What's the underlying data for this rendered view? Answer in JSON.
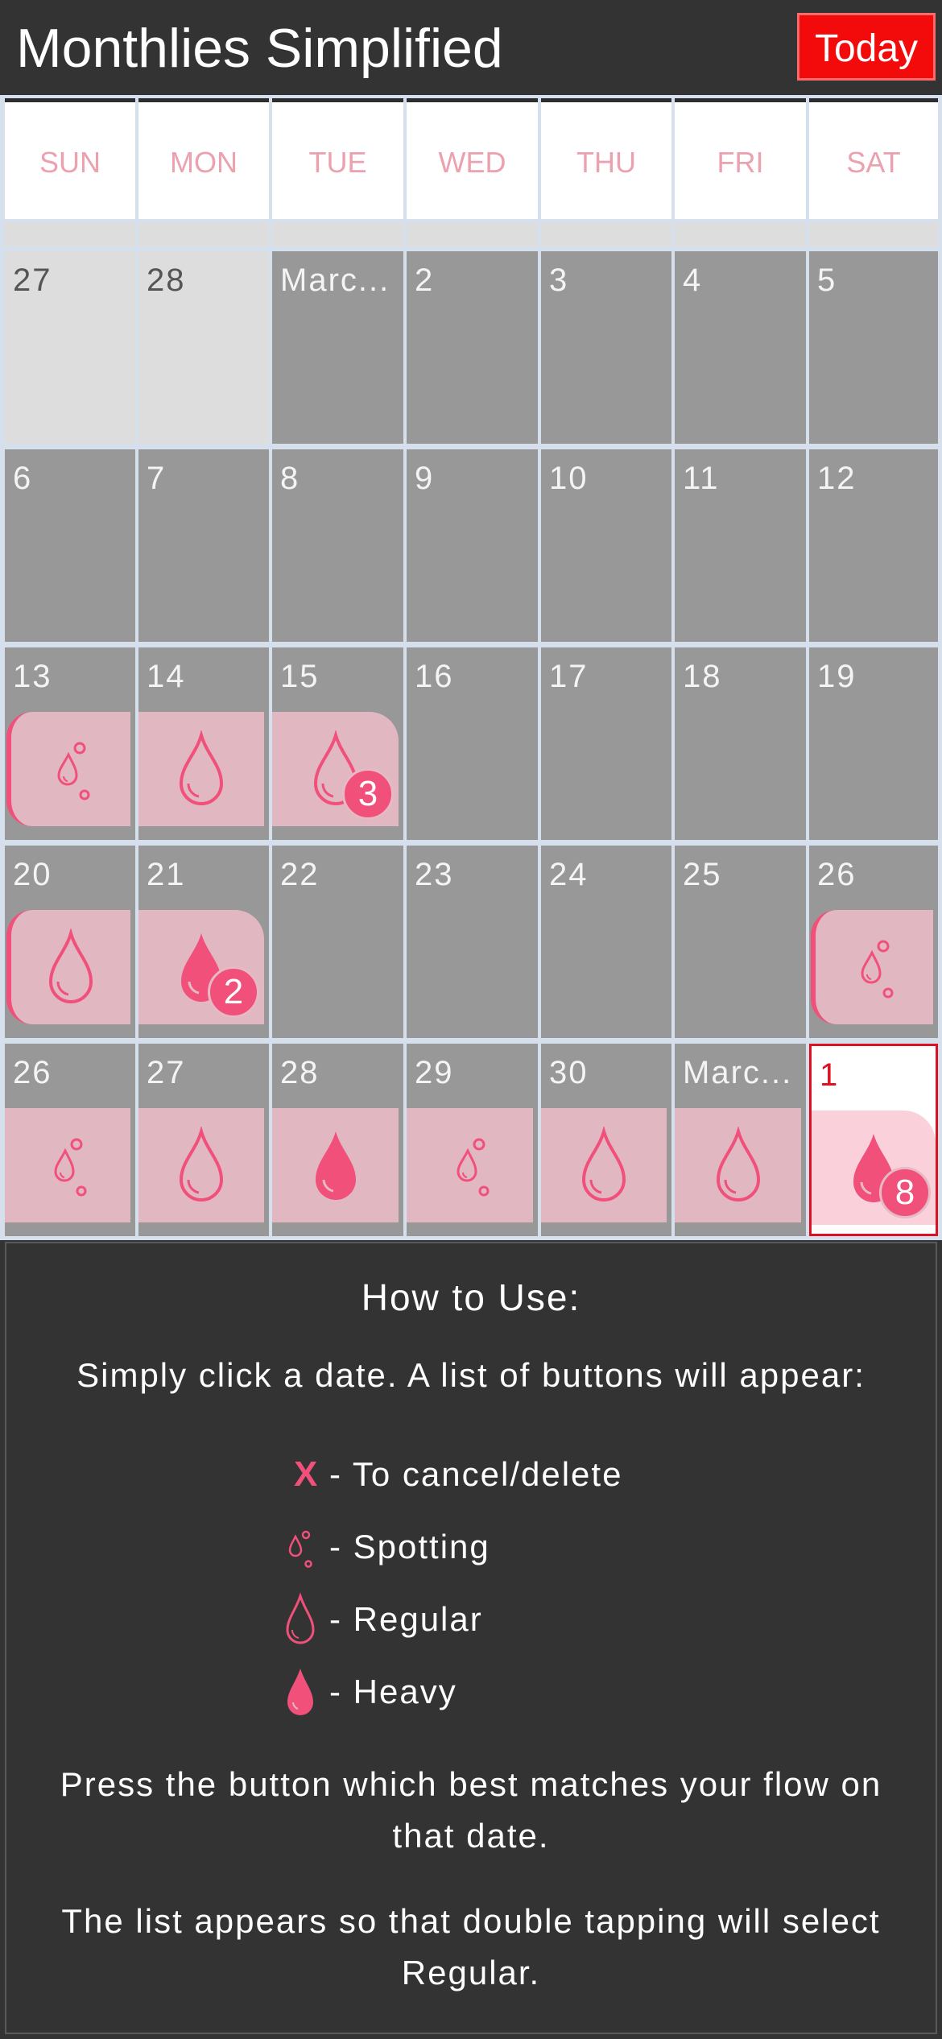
{
  "header": {
    "title": "Monthlies Simplified",
    "today_label": "Today"
  },
  "colors": {
    "accent": "#f0507a",
    "today_red": "#f30a0a",
    "flow_bg": "#e1b7c2",
    "cell_bg": "#989898"
  },
  "weekdays": [
    "SUN",
    "MON",
    "TUE",
    "WED",
    "THU",
    "FRI",
    "SAT"
  ],
  "weeks": [
    [
      {
        "day": "27",
        "other": true
      },
      {
        "day": "28",
        "other": true
      },
      {
        "day": "Marc..."
      },
      {
        "day": "2"
      },
      {
        "day": "3"
      },
      {
        "day": "4"
      },
      {
        "day": "5"
      }
    ],
    [
      {
        "day": "6"
      },
      {
        "day": "7"
      },
      {
        "day": "8"
      },
      {
        "day": "9"
      },
      {
        "day": "10"
      },
      {
        "day": "11"
      },
      {
        "day": "12"
      }
    ],
    [
      {
        "day": "13",
        "flow": "spotting"
      },
      {
        "day": "14",
        "flow": "regular"
      },
      {
        "day": "15",
        "flow": "regular",
        "badge": "3"
      },
      {
        "day": "16"
      },
      {
        "day": "17"
      },
      {
        "day": "18"
      },
      {
        "day": "19"
      }
    ],
    [
      {
        "day": "20",
        "flow": "regular"
      },
      {
        "day": "21",
        "flow": "heavy",
        "badge": "2"
      },
      {
        "day": "22"
      },
      {
        "day": "23"
      },
      {
        "day": "24"
      },
      {
        "day": "25"
      },
      {
        "day": "26",
        "flow": "spotting"
      }
    ],
    [
      {
        "day": "26",
        "flow": "spotting"
      },
      {
        "day": "27",
        "flow": "regular"
      },
      {
        "day": "28",
        "flow": "heavy"
      },
      {
        "day": "29",
        "flow": "spotting"
      },
      {
        "day": "30",
        "flow": "regular"
      },
      {
        "day": "Marc...",
        "flow": "regular"
      },
      {
        "day": "1",
        "flow": "heavy",
        "badge": "8",
        "today": true
      }
    ]
  ],
  "help": {
    "title": "How to Use:",
    "intro": "Simply click a date. A list of buttons will appear:",
    "legend": [
      {
        "icon": "x-icon",
        "symbol": "X",
        "text": "- To cancel/delete"
      },
      {
        "icon": "spotting-icon",
        "text": "- Spotting"
      },
      {
        "icon": "regular-drop-icon",
        "text": "- Regular"
      },
      {
        "icon": "heavy-drop-icon",
        "text": "- Heavy"
      }
    ],
    "para1": "Press the button which best matches your flow on that date.",
    "para2": "The list appears so that double tapping will select Regular."
  }
}
